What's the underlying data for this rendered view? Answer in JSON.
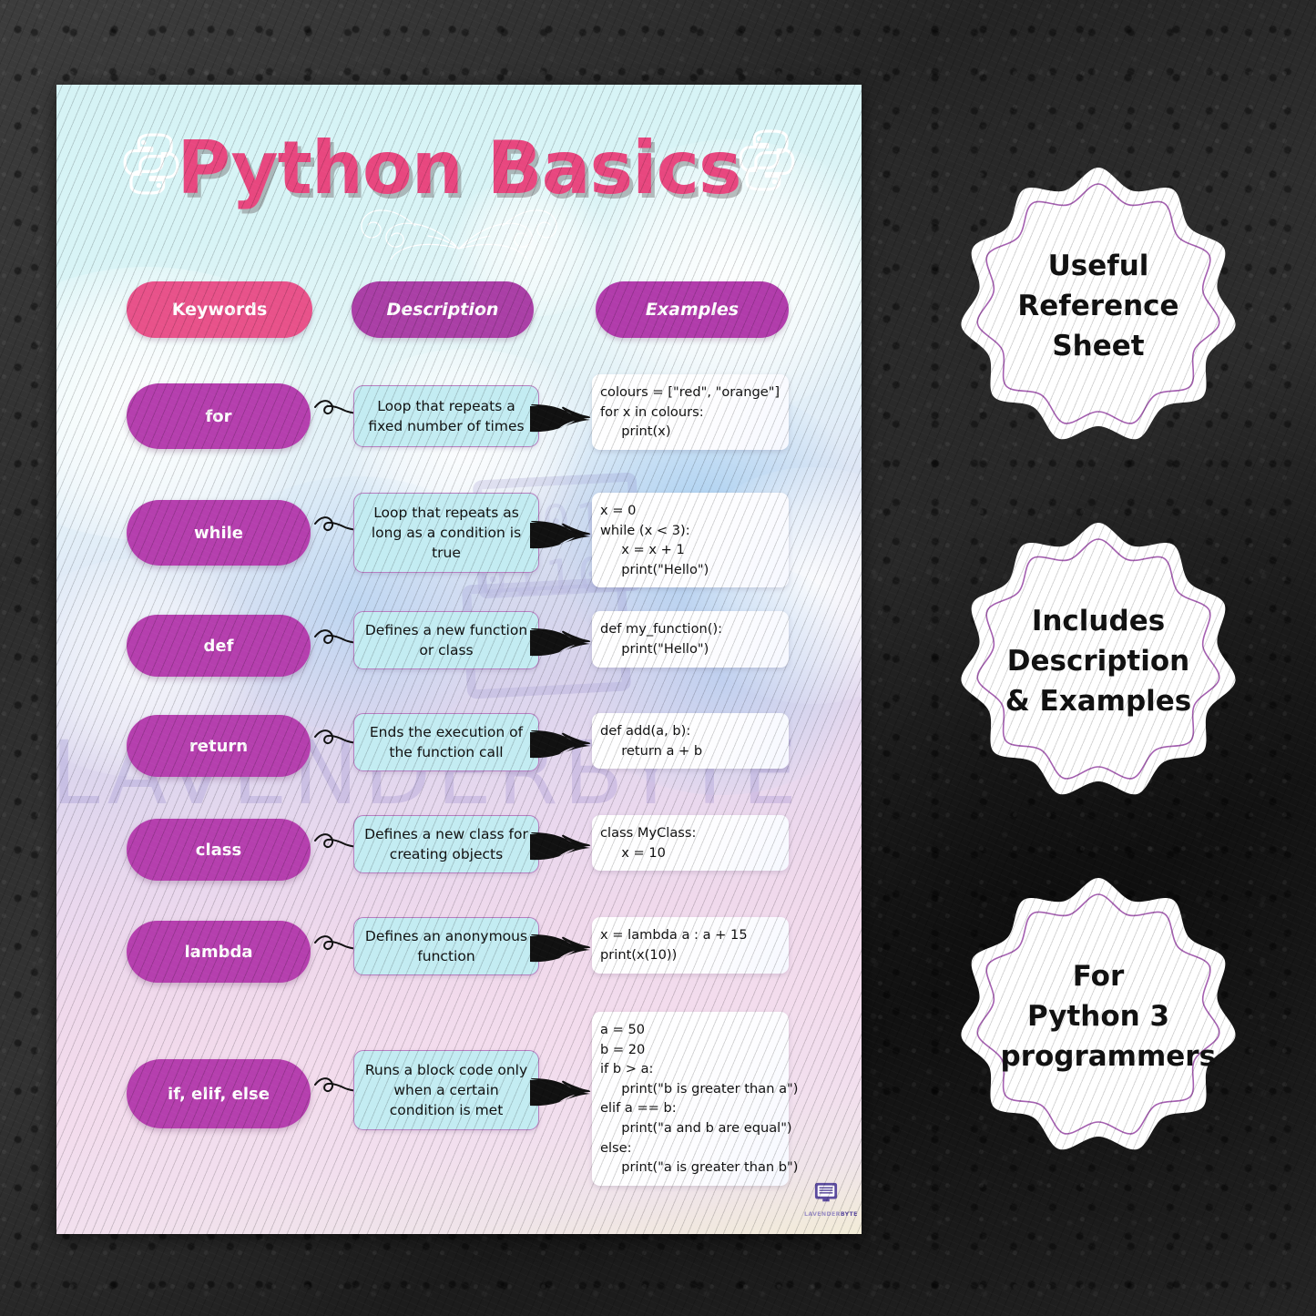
{
  "poster": {
    "title": "Python Basics",
    "brand": {
      "name_part1": "LAVENDER",
      "name_part2": "BYTE",
      "watermark": "LAVENDERBYTE"
    },
    "columns": {
      "keywords": "Keywords",
      "description": "Description",
      "examples": "Examples"
    },
    "colors": {
      "title_pink": "#e8477f",
      "keywords_pill": "#e8528a",
      "description_pill": "#aa3fa6",
      "examples_pill": "#b13cab",
      "keyword_row_pill": "#b53fae",
      "desc_box_fill": "#c3ecf2",
      "desc_box_border": "#b77ec0",
      "badge_outline": "#a45fb0"
    },
    "rows": [
      {
        "keyword": "for",
        "description": "Loop that repeats a fixed number of times",
        "example": "colours = [\"red\", \"orange\"]\nfor x in colours:\n     print(x)"
      },
      {
        "keyword": "while",
        "description": "Loop that repeats as long as a condition is true",
        "example": "x = 0\nwhile (x < 3):\n     x = x + 1\n     print(\"Hello\")"
      },
      {
        "keyword": "def",
        "description": "Defines a new function or class",
        "example": "def my_function():\n     print(\"Hello\")"
      },
      {
        "keyword": "return",
        "description": "Ends the execution of the function call",
        "example": "def add(a, b):\n     return a + b"
      },
      {
        "keyword": "class",
        "description": "Defines a new class for creating objects",
        "example": "class MyClass:\n     x = 10"
      },
      {
        "keyword": "lambda",
        "description": "Defines an anonymous function",
        "example": "x = lambda a : a + 15\nprint(x(10))"
      },
      {
        "keyword": "if, elif, else",
        "description": "Runs a block code only when a certain condition is met",
        "example": "a = 50\nb = 20\nif b > a:\n     print(\"b is greater than a\")\nelif a == b:\n     print(\"a and b are equal\")\nelse:\n     print(\"a is greater than b\")"
      }
    ],
    "watermark_digits": "10011\n011001"
  },
  "badges": [
    {
      "line1": "Useful",
      "line2": "Reference",
      "line3": "Sheet"
    },
    {
      "line1": "Includes",
      "line2": "Description",
      "line3": "& Examples"
    },
    {
      "line1": "For",
      "line2": "Python 3",
      "line3": "programmers"
    }
  ]
}
